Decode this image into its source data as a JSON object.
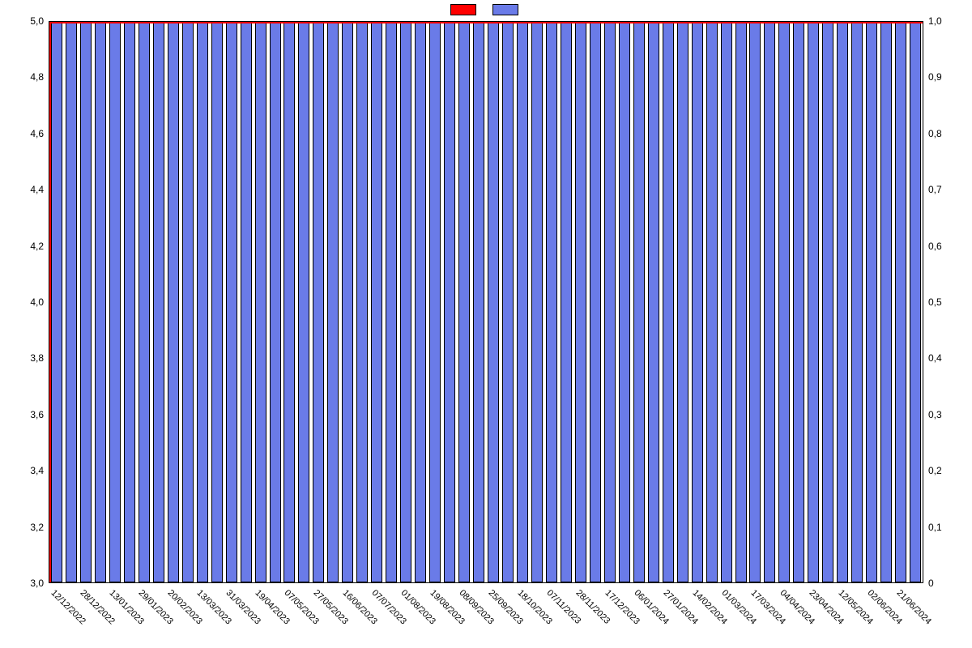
{
  "chart_data": {
    "type": "bar",
    "categories": [
      "12/12/2022",
      "28/12/2022",
      "13/01/2023",
      "29/01/2023",
      "20/02/2023",
      "13/03/2023",
      "31/03/2023",
      "19/04/2023",
      "07/05/2023",
      "27/05/2023",
      "16/06/2023",
      "07/07/2023",
      "01/08/2023",
      "19/08/2023",
      "08/09/2023",
      "25/09/2023",
      "18/10/2023",
      "07/11/2023",
      "28/11/2023",
      "17/12/2023",
      "06/01/2024",
      "27/01/2024",
      "14/02/2024",
      "01/03/2024",
      "17/03/2024",
      "04/04/2024",
      "23/04/2024",
      "12/05/2024",
      "02/06/2024",
      "21/06/2024"
    ],
    "series": [
      {
        "name": "",
        "color": "#ff0000",
        "axis": "left",
        "type": "line",
        "values": [
          5.0,
          5.0,
          5.0,
          5.0,
          5.0,
          5.0,
          5.0,
          5.0,
          5.0,
          5.0,
          5.0,
          5.0,
          5.0,
          5.0,
          5.0,
          5.0,
          5.0,
          5.0,
          5.0,
          5.0,
          5.0,
          5.0,
          5.0,
          5.0,
          5.0,
          5.0,
          5.0,
          5.0,
          5.0,
          5.0,
          5.0,
          5.0,
          5.0,
          5.0,
          5.0,
          5.0,
          5.0,
          5.0,
          5.0,
          5.0,
          5.0,
          5.0,
          5.0,
          5.0,
          5.0,
          5.0,
          5.0,
          5.0,
          5.0,
          5.0,
          5.0,
          5.0,
          5.0,
          5.0,
          5.0,
          5.0,
          5.0,
          5.0,
          5.0,
          5.0
        ]
      },
      {
        "name": "",
        "color": "#6a7be8",
        "axis": "right",
        "type": "bar",
        "values": [
          1,
          1,
          1,
          1,
          1,
          1,
          1,
          1,
          1,
          1,
          1,
          1,
          1,
          1,
          1,
          1,
          1,
          1,
          1,
          1,
          1,
          1,
          1,
          1,
          1,
          1,
          1,
          1,
          1,
          1,
          1,
          1,
          1,
          1,
          1,
          1,
          1,
          1,
          1,
          1,
          1,
          1,
          1,
          1,
          1,
          1,
          1,
          1,
          1,
          1,
          1,
          1,
          1,
          1,
          1,
          1,
          1,
          1,
          1,
          1
        ]
      }
    ],
    "bar_count": 60,
    "y_left": {
      "min": 3.0,
      "max": 5.0,
      "ticks": [
        "3,0",
        "3,2",
        "3,4",
        "3,6",
        "3,8",
        "4,0",
        "4,2",
        "4,4",
        "4,6",
        "4,8",
        "5,0"
      ]
    },
    "y_right": {
      "min": 0.0,
      "max": 1.0,
      "ticks": [
        "0",
        "0,1",
        "0,2",
        "0,3",
        "0,4",
        "0,5",
        "0,6",
        "0,7",
        "0,8",
        "0,9",
        "1,0"
      ]
    },
    "title": "",
    "xlabel": "",
    "ylabel_left": "",
    "ylabel_right": "",
    "legend": [
      "",
      ""
    ]
  }
}
